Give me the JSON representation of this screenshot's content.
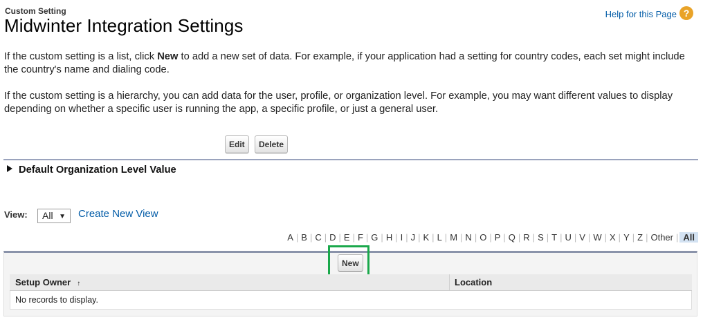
{
  "header": {
    "breadcrumb": "Custom Setting",
    "title": "Midwinter Integration Settings",
    "help_link": "Help for this Page",
    "help_icon": "?"
  },
  "description": {
    "p1_before": "If the custom setting is a list, click ",
    "p1_bold": "New",
    "p1_after": " to add a new set of data. For example, if your application had a setting for country codes, each set might include the country's name and dialing code.",
    "p2": "If the custom setting is a hierarchy, you can add data for the user, profile, or organization level. For example, you may want different values to display depending on whether a specific user is running the app, a specific profile, or just a general user."
  },
  "toolbar": {
    "edit_label": "Edit",
    "delete_label": "Delete"
  },
  "section": {
    "title": "Default Organization Level Value"
  },
  "view": {
    "label": "View:",
    "selected": "All",
    "create_link": "Create New View"
  },
  "alphabet": [
    "A",
    "B",
    "C",
    "D",
    "E",
    "F",
    "G",
    "H",
    "I",
    "J",
    "K",
    "L",
    "M",
    "N",
    "O",
    "P",
    "Q",
    "R",
    "S",
    "T",
    "U",
    "V",
    "W",
    "X",
    "Y",
    "Z",
    "Other",
    "All"
  ],
  "alphabet_active": "All",
  "list": {
    "new_label": "New",
    "columns": [
      "Setup Owner",
      "Location"
    ],
    "sort_indicator": "↑",
    "empty_message": "No records to display."
  },
  "colors": {
    "link": "#015ba7",
    "highlight": "#1aa84b",
    "help_icon": "#e9a328"
  }
}
